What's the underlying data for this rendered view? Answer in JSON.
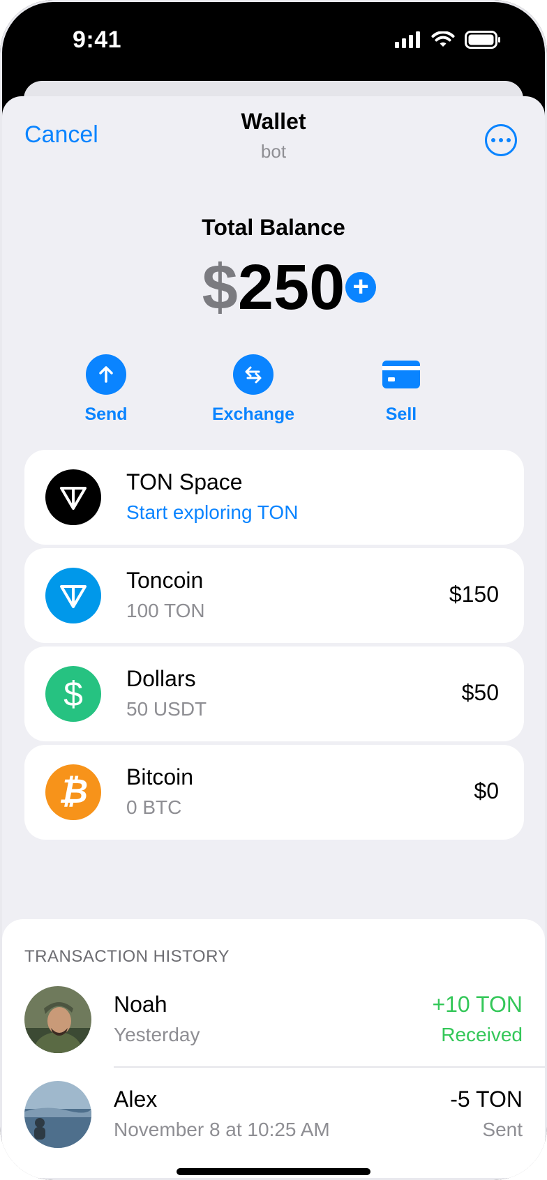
{
  "status_bar": {
    "time": "9:41"
  },
  "nav": {
    "cancel": "Cancel",
    "title": "Wallet",
    "subtitle": "bot"
  },
  "balance": {
    "label": "Total Balance",
    "currency": "$",
    "amount": "250"
  },
  "actions": [
    {
      "label": "Send",
      "icon": "arrow-up-icon"
    },
    {
      "label": "Exchange",
      "icon": "swap-arrows-icon"
    },
    {
      "label": "Sell",
      "icon": "credit-card-icon"
    }
  ],
  "assets": [
    {
      "name": "TON Space",
      "sub": "Start exploring TON",
      "value": "",
      "icon": "ton-space-icon",
      "icon_color": "#000000"
    },
    {
      "name": "Toncoin",
      "sub": "100 TON",
      "value": "$150",
      "icon": "toncoin-icon",
      "icon_color": "#0098ea"
    },
    {
      "name": "Dollars",
      "sub": "50 USDT",
      "value": "$50",
      "icon": "dollar-icon",
      "icon_color": "#26c281"
    },
    {
      "name": "Bitcoin",
      "sub": "0 BTC",
      "value": "$0",
      "icon": "bitcoin-icon",
      "icon_color": "#f7931a"
    }
  ],
  "history": {
    "title": "TRANSACTION HISTORY",
    "items": [
      {
        "name": "Noah",
        "date": "Yesterday",
        "amount": "+10 TON",
        "status": "Received"
      },
      {
        "name": "Alex",
        "date": "November 8 at 10:25 AM",
        "amount": "-5 TON",
        "status": "Sent"
      }
    ]
  },
  "colors": {
    "accent": "#0a84ff",
    "received": "#34c759",
    "secondary_text": "#8e8e93",
    "background": "#efeff4"
  }
}
